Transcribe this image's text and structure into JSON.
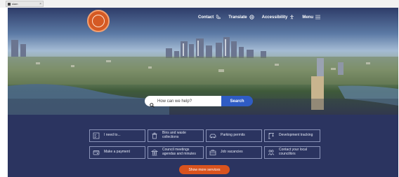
{
  "browser": {
    "tab_title": "slam"
  },
  "nav": {
    "contact": "Contact",
    "translate": "Translate",
    "accessibility": "Accessibility",
    "menu": "Menu"
  },
  "search": {
    "placeholder": "How can we help?",
    "button": "Search"
  },
  "services": [
    {
      "label": "I need to...",
      "icon": "checklist-icon"
    },
    {
      "label": "Bins and waste collections",
      "icon": "bin-icon"
    },
    {
      "label": "Parking permits",
      "icon": "car-icon"
    },
    {
      "label": "Development tracking",
      "icon": "crane-icon"
    },
    {
      "label": "Make a payment",
      "icon": "payment-icon"
    },
    {
      "label": "Council meetings agendas and minutes",
      "icon": "building-icon"
    },
    {
      "label": "Job vacancies",
      "icon": "job-icon"
    },
    {
      "label": "Contact your local councillors",
      "icon": "people-icon"
    }
  ],
  "more_button": "Show more services",
  "colors": {
    "band": "#2b3460",
    "search_button": "#2f5cc4",
    "accent": "#d9531e",
    "logo": "#d55a24"
  }
}
